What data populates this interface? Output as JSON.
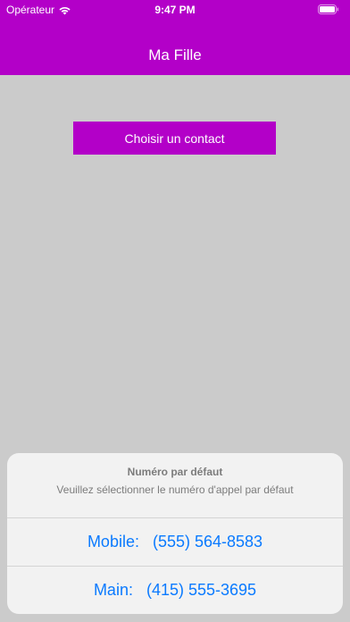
{
  "status_bar": {
    "carrier": "Opérateur",
    "time": "9:47 PM",
    "wifi_icon": "wifi-icon",
    "battery_icon": "battery-icon"
  },
  "nav": {
    "title": "Ma Fille"
  },
  "main": {
    "choose_contact_label": "Choisir un contact"
  },
  "action_sheet": {
    "title": "Numéro par défaut",
    "message": "Veuillez sélectionner le numéro d'appel par défaut",
    "options": [
      {
        "label": "Mobile:   (555) 564-8583"
      },
      {
        "label": "Main:   (415) 555-3695"
      }
    ]
  },
  "colors": {
    "brand": "#b300c8",
    "background": "#cbcbcb",
    "action_blue": "#0a7aff"
  }
}
